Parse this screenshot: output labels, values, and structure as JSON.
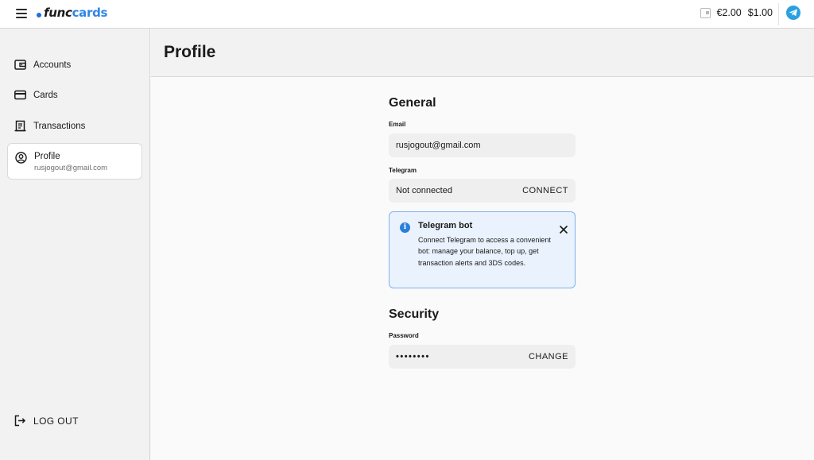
{
  "header": {
    "logo_prefix": "func",
    "logo_suffix": "cards",
    "balance_eur": "€2.00",
    "balance_usd": "$1.00"
  },
  "sidebar": {
    "items": [
      {
        "label": "Accounts",
        "icon": "wallet-icon"
      },
      {
        "label": "Cards",
        "icon": "card-icon"
      },
      {
        "label": "Transactions",
        "icon": "receipt-icon"
      },
      {
        "label": "Profile",
        "sub": "rusjogout@gmail.com",
        "icon": "user-circle-icon"
      }
    ],
    "logout_label": "LOG OUT"
  },
  "page": {
    "title": "Profile"
  },
  "general": {
    "title": "General",
    "email_label": "Email",
    "email_value": "rusjogout@gmail.com",
    "telegram_label": "Telegram",
    "telegram_value": "Not connected",
    "telegram_action": "CONNECT",
    "alert_title": "Telegram bot",
    "alert_body": "Connect Telegram to access a convenient bot: manage your balance, top up, get transaction alerts and 3DS codes."
  },
  "security": {
    "title": "Security",
    "password_label": "Password",
    "password_value": "••••••••",
    "password_action": "CHANGE"
  },
  "colors": {
    "accent": "#2f86e8",
    "alert_bg": "#eaf2fd",
    "alert_border": "#7fb3ec",
    "telegram": "#2aa0e0"
  }
}
